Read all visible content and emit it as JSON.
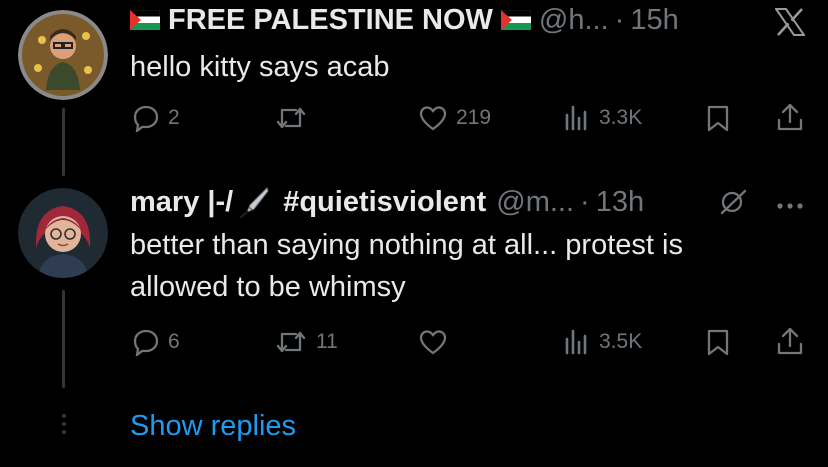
{
  "tweet1": {
    "display_name": "FREE PALESTINE NOW",
    "handle": "@h...",
    "separator": "·",
    "time": "15h",
    "text": "hello kitty says acab",
    "replies": "2",
    "reposts": "",
    "likes": "219",
    "views": "3.3K"
  },
  "tweet2": {
    "display_name": "mary |-/",
    "display_name_tag": "#quietisviolent",
    "handle": "@m...",
    "separator": "·",
    "time": "13h",
    "text": "better than saying nothing at all... protest is allowed to be whimsy",
    "replies": "6",
    "reposts": "11",
    "likes": "",
    "views": "3.5K"
  },
  "show_replies_label": "Show replies",
  "colors": {
    "background": "#000000",
    "text": "#e7e9ea",
    "muted": "#71767b",
    "link": "#1d9bf0",
    "thread_line": "#333639"
  },
  "icons": [
    "x-logo-icon",
    "palestine-flag-icon",
    "reply-icon",
    "repost-icon",
    "like-icon",
    "views-icon",
    "bookmark-icon",
    "share-icon",
    "grok-icon",
    "more-icon",
    "pen-icon"
  ]
}
